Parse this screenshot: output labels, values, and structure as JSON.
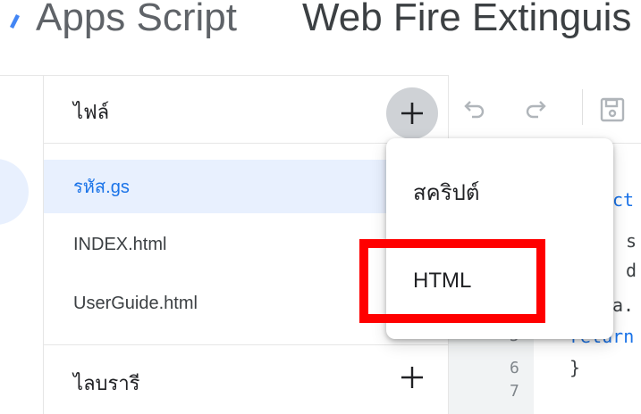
{
  "header": {
    "app_title": "Apps Script",
    "project_title": "Web Fire Extinguis"
  },
  "files_panel": {
    "title": "ไฟล์",
    "files": [
      {
        "label": "รหัส.gs",
        "active": true
      },
      {
        "label": "INDEX.html",
        "active": false
      },
      {
        "label": "UserGuide.html",
        "active": false
      }
    ],
    "libraries_title": "ไลบรารี"
  },
  "menu": {
    "items": [
      {
        "label": "สคริปต์"
      },
      {
        "label": "HTML"
      }
    ]
  },
  "editor": {
    "visible_line_numbers": [
      "5",
      "6",
      "7"
    ],
    "code_fragments": [
      "ct",
      "s",
      "d",
      "a.",
      "return",
      "}"
    ]
  },
  "icons": {
    "add": "plus-icon",
    "undo": "undo-icon",
    "redo": "redo-icon",
    "save": "save-icon"
  },
  "colors": {
    "accent": "#1a73e8",
    "active_file_bg": "#e8f0fe",
    "highlight": "#ff0000",
    "add_button_bg": "#cfd2d6"
  }
}
